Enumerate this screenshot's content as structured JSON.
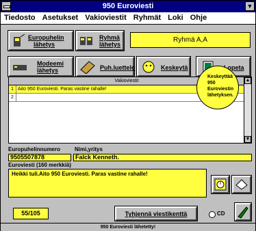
{
  "window": {
    "title": "950 Euroviesti"
  },
  "menu": [
    "Tiedosto",
    "Asetukset",
    "Vakioviestit",
    "Ryhmät",
    "Loki",
    "Ohje"
  ],
  "toolbar": {
    "europuhelin_line1": "Europuhelin",
    "europuhelin_line2": "lähetys",
    "ryhma_line1": "Ryhmä",
    "ryhma_line2": "lähetys",
    "group_display": "Ryhmä A,A",
    "modeemi_line1": "Modeemi",
    "modeemi_line2": "lähetys",
    "puhluettelo": "Puh.luettelo",
    "keskeyta": "Keskeytä",
    "lopeta": "Lopeta"
  },
  "tooltip": {
    "text": "Keskeyttää 950 Euroviestin lähetyksen."
  },
  "grid": {
    "header": "Vakioviestit",
    "rows": [
      {
        "num": "1",
        "text": "Aito 950 Euroviesti. Paras vastine rahalle!"
      },
      {
        "num": "2",
        "text": ""
      }
    ]
  },
  "form": {
    "phone_label": "Europuhelinnumero",
    "phone_value": "9505507878",
    "name_label": "Nimi,yritys",
    "name_value": "Falck Kenneth.",
    "message_label": "Euroviesti (160 merkkiä)",
    "message_value": "Heikki tuli.Aito 950 Euroviesti. Paras vastine rahalle!",
    "counter": "55/105",
    "clear_button": "Tyhjennä viestikenttä",
    "cd_label": "CD"
  },
  "status": {
    "text": "950 Euroviesti lähetetty!"
  },
  "colors": {
    "titlebar": "#000080",
    "highlight": "#ffff40",
    "face": "#c0c0c0"
  }
}
